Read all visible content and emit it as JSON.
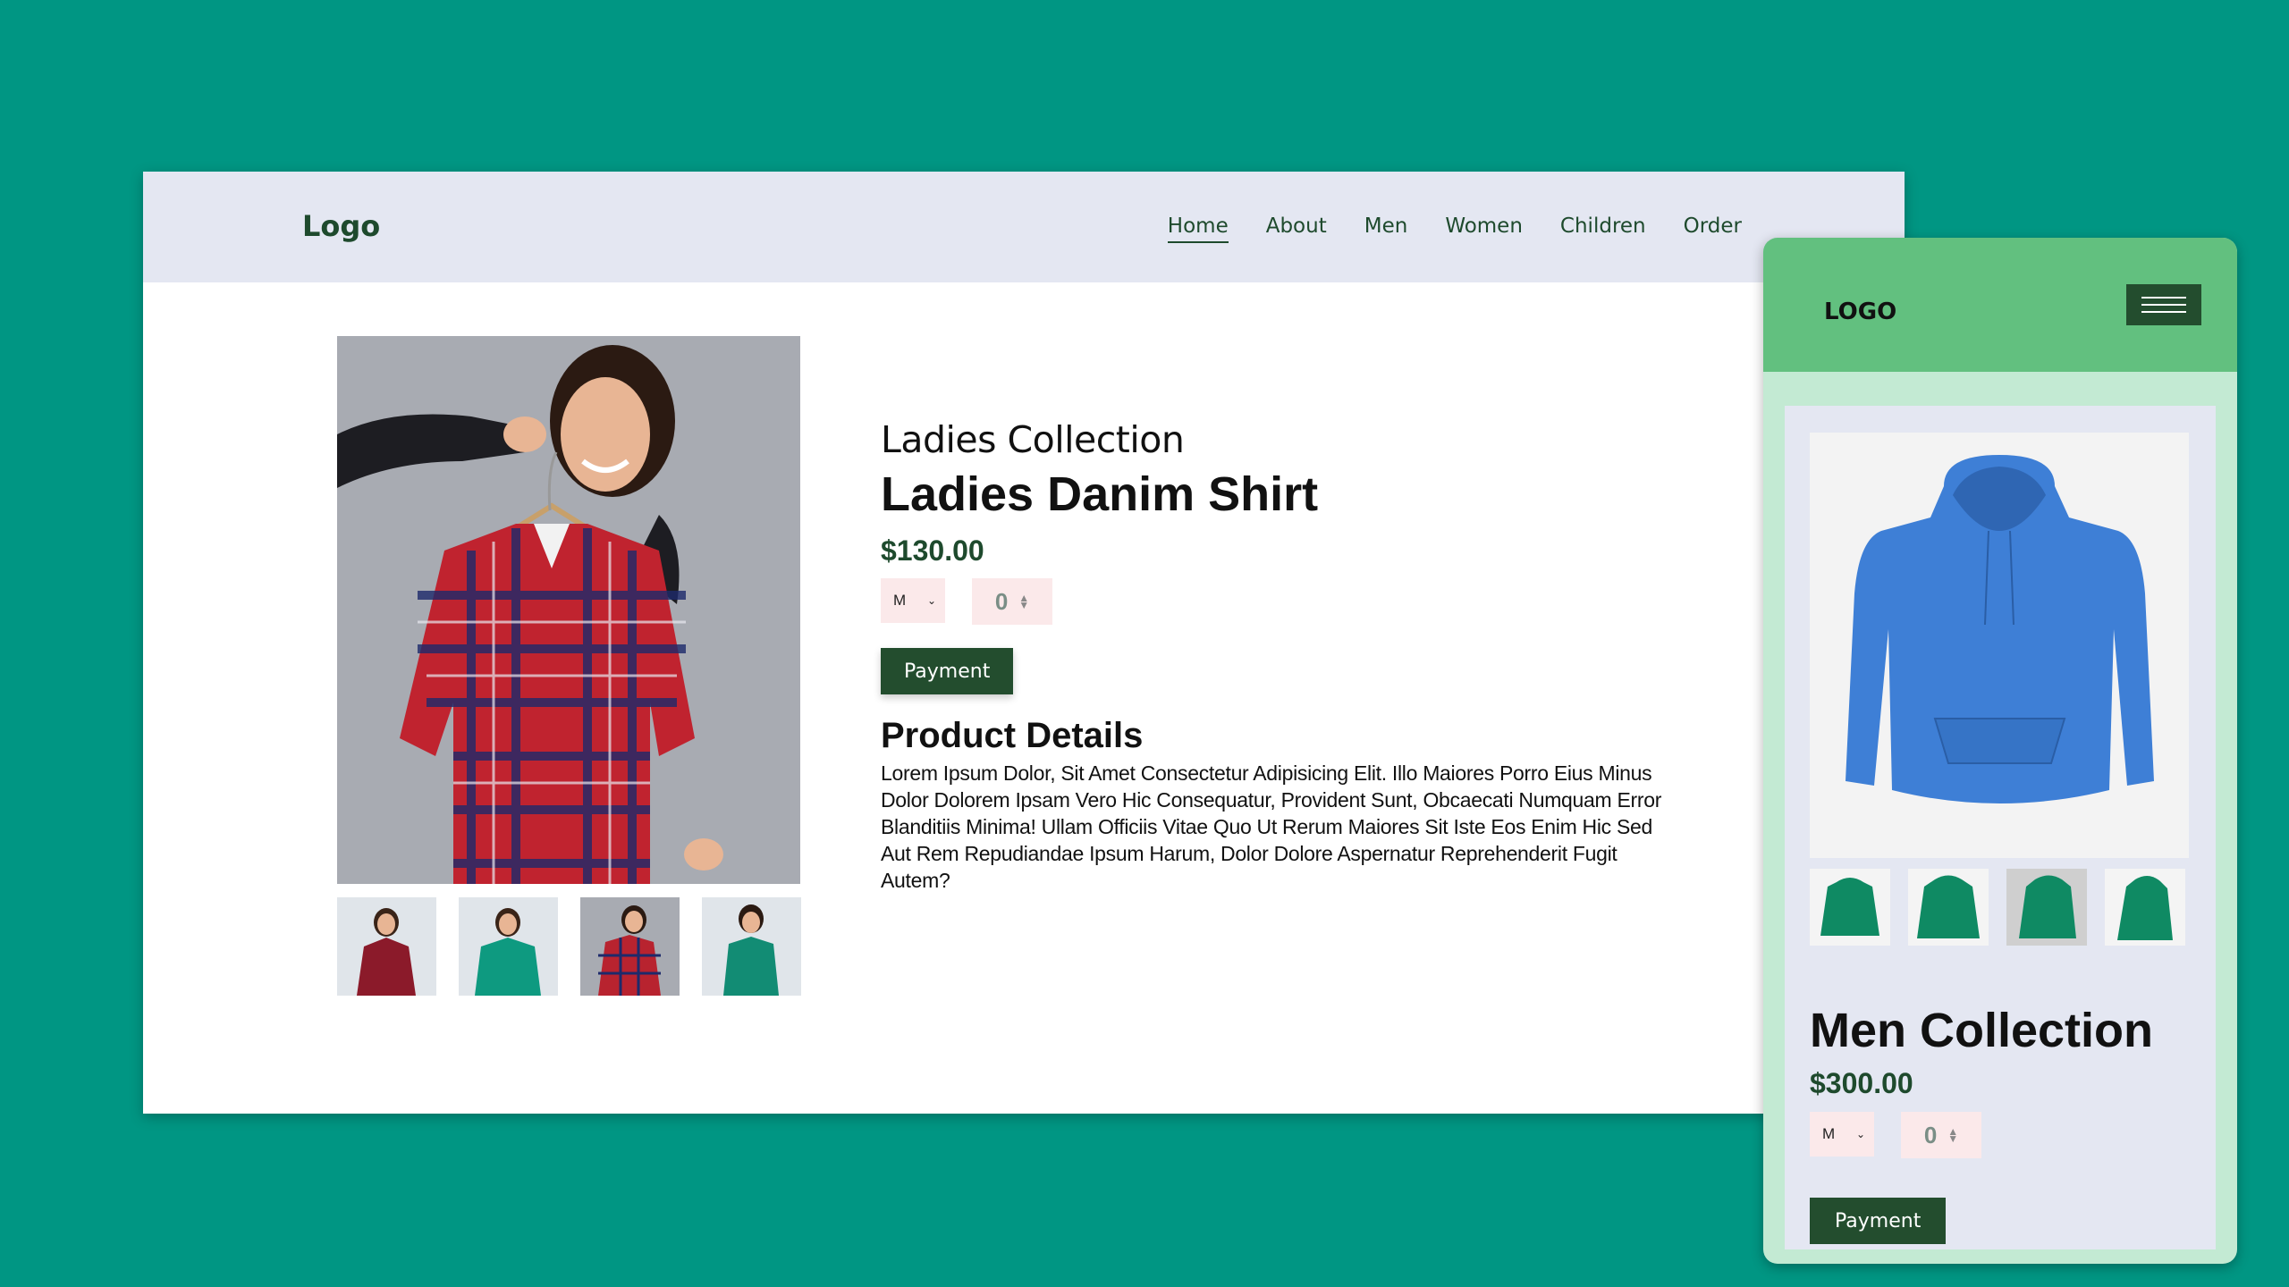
{
  "desktop": {
    "logo": "Logo",
    "nav": [
      {
        "label": "Home",
        "active": true
      },
      {
        "label": "About"
      },
      {
        "label": "Men"
      },
      {
        "label": "Women"
      },
      {
        "label": "Children"
      },
      {
        "label": "Order"
      }
    ],
    "product": {
      "collection": "Ladies Collection",
      "title": "Ladies Danim Shirt",
      "price": "$130.00",
      "size_selected": "M",
      "quantity": "0",
      "payment_label": "Payment",
      "details_heading": "Product Details",
      "details_text": "Lorem Ipsum Dolor, Sit Amet Consectetur Adipisicing Elit. Illo Maiores Porro Eius Minus Dolor Dolorem Ipsam Vero Hic Consequatur, Provident Sunt, Obcaecati Numquam Error Blanditiis Minima! Ullam Officiis Vitae Quo Ut Rerum Maiores Sit Iste Eos Enim Hic Sed Aut Rem Repudiandae Ipsum Harum, Dolor Dolore Aspernatur Reprehenderit Fugit Autem?"
    }
  },
  "mobile": {
    "logo": "LOGO",
    "product": {
      "title": "Men Collection",
      "price": "$300.00",
      "size_selected": "M",
      "quantity": "0",
      "payment_label": "Payment"
    }
  },
  "colors": {
    "background": "#009683",
    "dark_green": "#234d2e",
    "mobile_header": "#62c07f",
    "nav_bg": "#e4e7f2"
  }
}
